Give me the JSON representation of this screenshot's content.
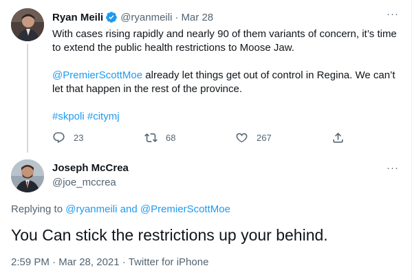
{
  "parent_tweet": {
    "author_name": "Ryan Meili",
    "handle": "@ryanmeili",
    "separator": "·",
    "date": "Mar 28",
    "paragraph_1": "With cases rising rapidly and  nearly 90 of them variants of concern, it’s time to extend the public health restrictions to Moose Jaw.",
    "mention": "@PremierScottMoe",
    "paragraph_2_rest": " already let things get out of control in Regina. We can’t let that happen in the rest of the province.",
    "hashtag_1": "#skpoli",
    "hashtag_2": "#citymj",
    "reply_count": "23",
    "retweet_count": "68",
    "like_count": "267",
    "more_icon": "···"
  },
  "main_tweet": {
    "author_name": "Joseph McCrea",
    "handle": "@joe_mccrea",
    "more_icon": "···",
    "replying_prefix": "Replying to ",
    "replying_user_1": "@ryanmeili",
    "replying_and": " and ",
    "replying_user_2": "@PremierScottMoe",
    "text": "You Can stick the restrictions up your behind.",
    "time": "2:59 PM",
    "date": "Mar 28, 2021",
    "separator": "·",
    "source": "Twitter for iPhone"
  },
  "colors": {
    "link": "#1d9bf0",
    "secondary_text": "#536471",
    "thread_line": "#cfd9de"
  },
  "icons": {
    "verified": "verified-badge-icon",
    "reply": "reply-icon",
    "retweet": "retweet-icon",
    "like": "heart-icon",
    "share": "share-icon",
    "more": "more-icon"
  }
}
